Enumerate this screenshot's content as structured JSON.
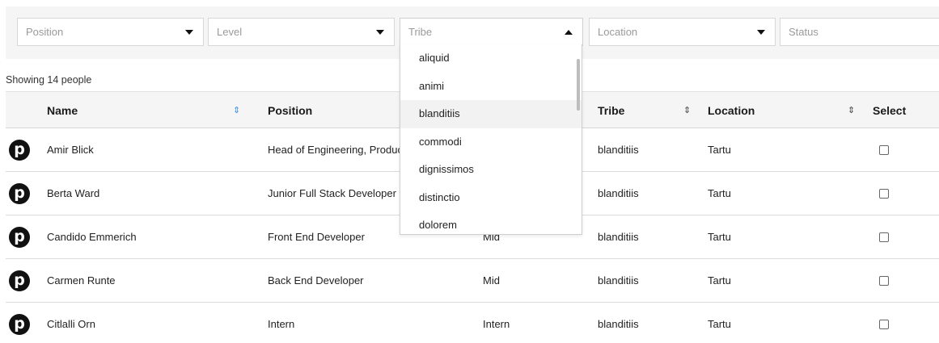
{
  "filters": {
    "position": {
      "placeholder": "Position"
    },
    "level": {
      "placeholder": "Level"
    },
    "tribe": {
      "placeholder": "Tribe"
    },
    "location": {
      "placeholder": "Location"
    },
    "status": {
      "placeholder": "Status"
    }
  },
  "summary": {
    "showing_text": "Showing 14 people"
  },
  "table": {
    "headers": {
      "name": "Name",
      "position": "Position",
      "tribe": "Tribe",
      "location": "Location",
      "select": "Select"
    },
    "rows": [
      {
        "name": "Amir Blick",
        "position": "Head of Engineering, Product",
        "level": "",
        "tribe": "blanditiis",
        "location": "Tartu"
      },
      {
        "name": "Berta Ward",
        "position": "Junior Full Stack Developer",
        "level": "",
        "tribe": "blanditiis",
        "location": "Tartu"
      },
      {
        "name": "Candido Emmerich",
        "position": "Front End Developer",
        "level": "Mid",
        "tribe": "blanditiis",
        "location": "Tartu"
      },
      {
        "name": "Carmen Runte",
        "position": "Back End Developer",
        "level": "Mid",
        "tribe": "blanditiis",
        "location": "Tartu"
      },
      {
        "name": "Citlalli Orn",
        "position": "Intern",
        "level": "Intern",
        "tribe": "blanditiis",
        "location": "Tartu"
      }
    ],
    "avatar_glyph": "p",
    "sort_icon": "⇕"
  },
  "tribe_dropdown": {
    "options": [
      "aliquid",
      "animi",
      "blanditiis",
      "commodi",
      "dignissimos",
      "distinctio",
      "dolorem"
    ],
    "highlighted": "blanditiis"
  },
  "colors": {
    "sort_active": "#3d8fe6",
    "header_bg": "#f5f5f5"
  }
}
